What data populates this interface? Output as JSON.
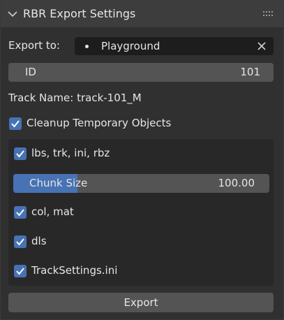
{
  "panel": {
    "title": "RBR Export Settings"
  },
  "export_to": {
    "label": "Export to:",
    "value": "Playground"
  },
  "id_field": {
    "label": "ID",
    "value": "101"
  },
  "track_name": "Track Name: track-101_M",
  "cleanup": {
    "label": "Cleanup Temporary Objects",
    "checked": true
  },
  "options": [
    {
      "label": "lbs, trk, ini, rbz",
      "checked": true
    },
    {
      "label": "col, mat",
      "checked": true
    },
    {
      "label": "dls",
      "checked": true
    },
    {
      "label": "TrackSettings.ini",
      "checked": true
    }
  ],
  "chunk_size": {
    "label": "Chunk Size",
    "value": "100.00",
    "fill_fraction": 0.25
  },
  "export_button": "Export",
  "colors": {
    "accent": "#4772b3",
    "field_dark": "#1d1d1d",
    "button": "#545454",
    "panel": "#303030",
    "header": "#3d3d3d"
  },
  "icons": {
    "collapse": "chevron-down-icon",
    "grip": "drag-grip-icon",
    "object": "object-dot-icon",
    "clear": "close-icon",
    "check": "checkmark-icon"
  }
}
